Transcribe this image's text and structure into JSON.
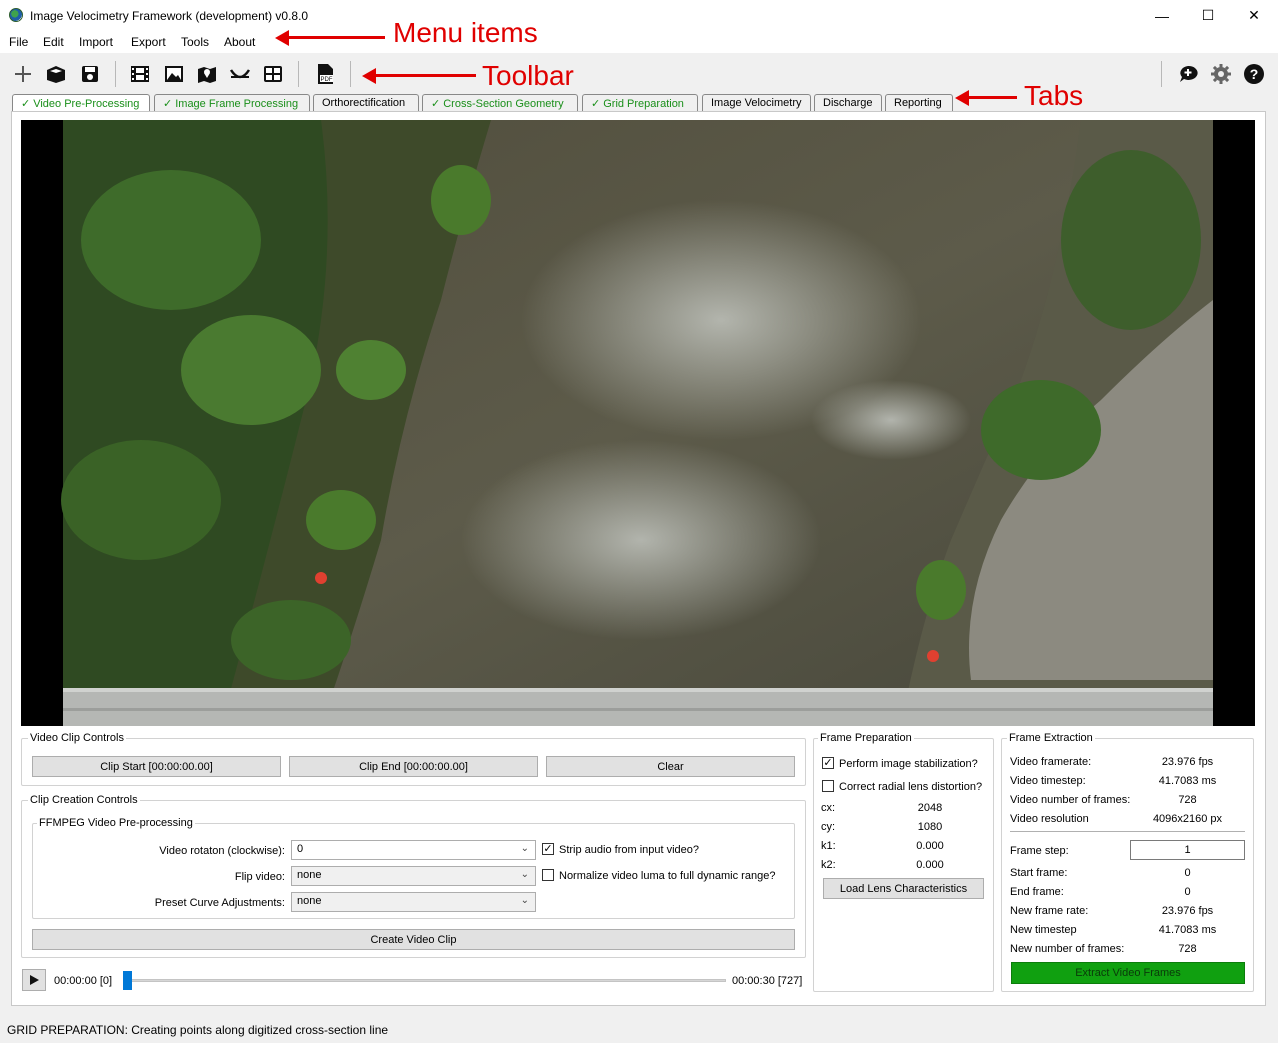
{
  "window": {
    "title": "Image Velocimetry Framework (development) v0.8.0",
    "minimize": "—",
    "maximize": "☐",
    "close": "✕"
  },
  "menu": [
    "File",
    "Edit",
    "Import",
    "Export",
    "Tools",
    "About"
  ],
  "toolbar": {
    "left": [
      "plus-icon",
      "open-project-icon",
      "save-icon",
      "film-icon",
      "image-icon",
      "map-icon",
      "cross-section-icon",
      "grid-icon",
      "pdf-icon"
    ],
    "right": [
      "feedback-icon",
      "gear-icon",
      "help-icon"
    ],
    "pdf_text": "PDF"
  },
  "tabs": [
    {
      "label": "Video Pre-Processing",
      "done": true,
      "active": true
    },
    {
      "label": "Image Frame Processing",
      "done": true
    },
    {
      "label": "Orthorectification",
      "done": false
    },
    {
      "label": "Cross-Section Geometry",
      "done": true
    },
    {
      "label": "Grid Preparation",
      "done": true
    },
    {
      "label": "Image Velocimetry",
      "done": false
    },
    {
      "label": "Discharge",
      "done": false
    },
    {
      "label": "Reporting",
      "done": false
    }
  ],
  "check_glyph": "✓",
  "annotations": {
    "menu": "Menu items",
    "toolbar": "Toolbar",
    "tabs": "Tabs"
  },
  "clip_controls": {
    "title": "Video Clip Controls",
    "clip_start": "Clip Start [00:00:00.00]",
    "clip_end": "Clip End [00:00:00.00]",
    "clear": "Clear"
  },
  "clip_creation": {
    "title": "Clip Creation Controls",
    "ffmpeg_title": "FFMPEG Video Pre-processing",
    "rotation_label": "Video rotaton (clockwise):",
    "rotation_value": "0",
    "flip_label": "Flip video:",
    "flip_value": "none",
    "curve_label": "Preset Curve Adjustments:",
    "curve_value": "none",
    "strip_audio": "Strip audio from input video?",
    "strip_audio_checked": true,
    "normalize_luma": "Normalize video luma to full dynamic range?",
    "normalize_luma_checked": false,
    "create_button": "Create Video Clip"
  },
  "player": {
    "current_time": "00:00:00 [0]",
    "end_time": "00:00:30 [727]",
    "progress": 0.0
  },
  "frame_preparation": {
    "title": "Frame Preparation",
    "stabilize": "Perform image stabilization?",
    "stabilize_checked": true,
    "lens": "Correct radial lens distortion?",
    "lens_checked": false,
    "params": [
      {
        "label": "cx:",
        "value": "2048"
      },
      {
        "label": "cy:",
        "value": "1080"
      },
      {
        "label": "k1:",
        "value": "0.000"
      },
      {
        "label": "k2:",
        "value": "0.000"
      }
    ],
    "load_button": "Load Lens Characteristics"
  },
  "frame_extraction": {
    "title": "Frame Extraction",
    "info": [
      {
        "label": "Video framerate:",
        "value": "23.976 fps"
      },
      {
        "label": "Video timestep:",
        "value": "41.7083 ms"
      },
      {
        "label": "Video number of frames:",
        "value": "728"
      },
      {
        "label": "Video resolution",
        "value": "4096x2160 px"
      }
    ],
    "frame_step_label": "Frame step:",
    "frame_step_value": "1",
    "settings": [
      {
        "label": "Start frame:",
        "value": "0"
      },
      {
        "label": "End frame:",
        "value": "0"
      },
      {
        "label": "New frame rate:",
        "value": "23.976 fps"
      },
      {
        "label": "New timestep",
        "value": "41.7083 ms"
      },
      {
        "label": "New number of frames:",
        "value": "728"
      }
    ],
    "extract_button": "Extract Video Frames"
  },
  "status": "GRID PREPARATION: Creating points along digitized cross-section line",
  "colors": {
    "accent_green": "#1a8f1a",
    "extract_green": "#10a010",
    "annotation_red": "#e00000",
    "slider_blue": "#0078d7"
  }
}
